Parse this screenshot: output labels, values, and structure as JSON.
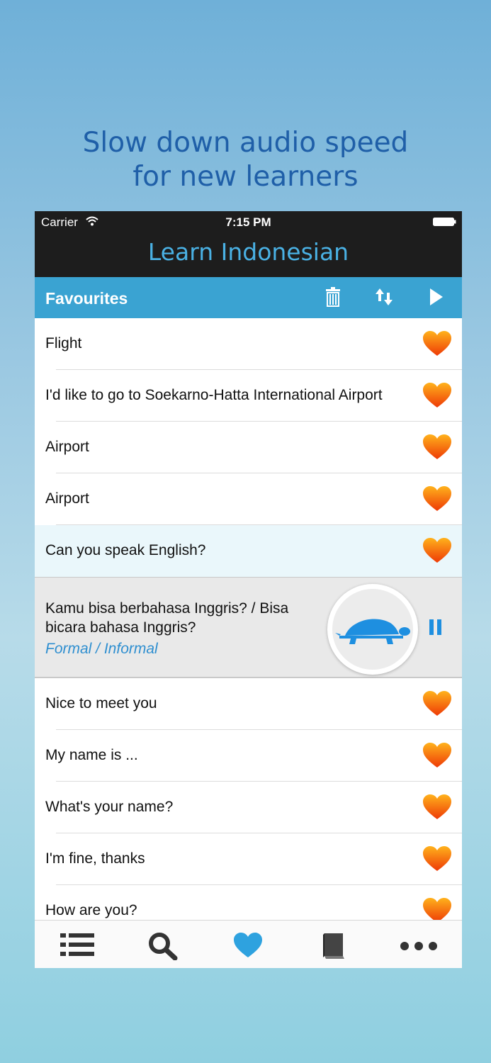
{
  "headline": {
    "line1": "Slow down audio speed",
    "line2": "for new learners"
  },
  "status": {
    "carrier": "Carrier",
    "time": "7:15 PM"
  },
  "app": {
    "title": "Learn Indonesian"
  },
  "toolbar": {
    "label": "Favourites"
  },
  "colors": {
    "accent": "#3aa3d2",
    "heart": "#f2580c",
    "title": "#4ab1e4",
    "link": "#2f8fd0"
  },
  "phrases": [
    {
      "text": "Flight"
    },
    {
      "text": "I'd like to go to Soekarno-Hatta International Airport"
    },
    {
      "text": "Airport"
    },
    {
      "text": "Airport"
    },
    {
      "text": "Can you speak English?"
    }
  ],
  "expanded": {
    "native": "Kamu bisa berbahasa Inggris? / Bisa bicara bahasa Inggris?",
    "variant": "Formal / Informal"
  },
  "phrases_after": [
    {
      "text": "Nice to meet you"
    },
    {
      "text": "My name is ..."
    },
    {
      "text": "What's your name?"
    },
    {
      "text": "I'm fine, thanks"
    },
    {
      "text": "How are you?"
    }
  ],
  "tabs": [
    "list-icon",
    "search-icon",
    "heart-icon",
    "book-icon",
    "more-icon"
  ]
}
